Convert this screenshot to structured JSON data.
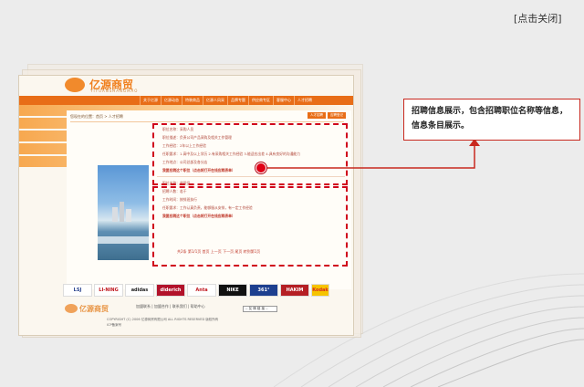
{
  "close_label": "[点击关闭]",
  "site": {
    "logo_text": "亿源商贸",
    "logo_sub": "YIYUANSHANGMAO",
    "nav_items": [
      "关于亿源",
      "亿源动态",
      "特装商品",
      "亿源人风采",
      "品牌专题",
      "供应商专区",
      "客服中心",
      "人才招聘"
    ],
    "sub_tabs": [
      "人才招聘",
      "应聘登记"
    ],
    "breadcrumb": "您现在的位置：首页 > 人才招聘",
    "jobs": [
      {
        "lines": [
          "职位名称：采购人员",
          "职位描述：负责公司产品采购及相关工作管理",
          "工作经验：2年以上工作经验",
          "任职要求：1.高中及以上学历 2.有采购相关工作经验 3.能适应出差 4.具有良好的沟通能力",
          "工作地点：公司总部及各分店"
        ],
        "apply": "我要应聘这个职位（点击将打开在线应聘表单）"
      },
      {
        "lines": [
          "职位名称：收银员",
          "招聘人数：若干",
          "工作时间：按排班执行",
          "任职要求：工作认真负责，能够服从安排，有一定工作经验"
        ],
        "apply": "我要应聘这个职位（点击将打开在线应聘表单）"
      }
    ],
    "pager": "共2条  第1/1页  首页  上一页  下一页  尾页  转到第1页",
    "brands": [
      "LSJ",
      "LI-NING",
      "adidas",
      "diderich",
      "Anta",
      "NIKE",
      "361°",
      "HAKIM",
      "Kodak"
    ],
    "footer_logo": "亿源商贸",
    "footer_links": "加盟联系 | 加盟合作 | 联系我们 | 帮助中心",
    "copyright": "COPYRIGHT (C) 2006 亿源商贸有限公司 ALL RIGHTS RESERVED 版权所有",
    "icp": "ICP备案号",
    "footer_select": "-- 友 情 链 接 --"
  },
  "callout": {
    "text_line1": "招聘信息展示，包含招聘职位名称等信息，",
    "text_line2": "信息条目展示。"
  },
  "colors": {
    "accent": "#e86d17",
    "annotation_red": "#d0021b"
  }
}
